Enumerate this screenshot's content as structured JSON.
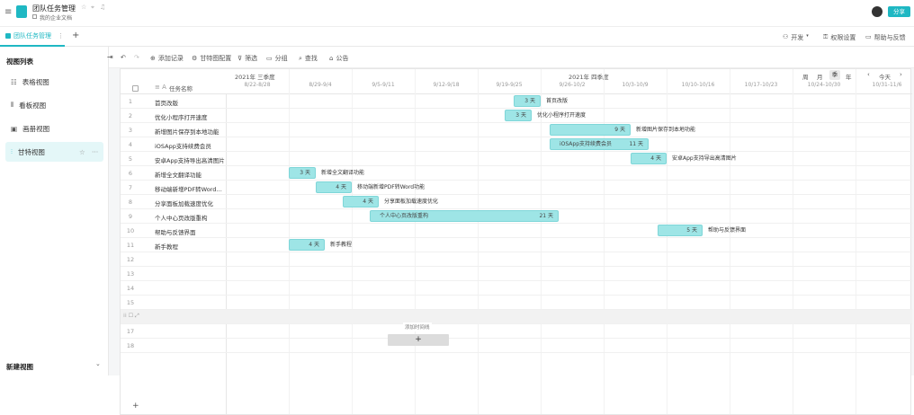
{
  "app": {
    "title": "团队任务管理",
    "workspace": "我的企业文档",
    "share_label": "分享",
    "brand_color": "#1fb8c3"
  },
  "tabs": {
    "active_label": "团队任务管理",
    "add_label": "+"
  },
  "topright": {
    "dev_label": "开发",
    "perm_label": "权限设置",
    "help_label": "帮助与反馈"
  },
  "sidebar": {
    "title": "视图列表",
    "items": [
      {
        "label": "表格视图",
        "icon": "table-icon"
      },
      {
        "label": "看板视图",
        "icon": "kanban-icon"
      },
      {
        "label": "画册视图",
        "icon": "gallery-icon"
      },
      {
        "label": "甘特视图",
        "icon": "gantt-icon"
      }
    ],
    "new_view_label": "新建视图"
  },
  "toolbar": {
    "add_record": "添加记录",
    "gantt_config": "甘特图配置",
    "filter": "筛选",
    "group": "分组",
    "find": "查找",
    "announce": "公告"
  },
  "gantt": {
    "header": {
      "check_label": "",
      "name_col": "任务名称",
      "q3_label": "2021年 三季度",
      "q4_label": "2021年 四季度",
      "scale_week": "周",
      "scale_month": "月",
      "scale_quarter": "季",
      "scale_year": "年",
      "today_label": "今天"
    },
    "weeks": [
      "8/22-8/28",
      "8/29-9/4",
      "9/5-9/11",
      "9/12-9/18",
      "9/19-9/25",
      "9/26-10/2",
      "10/3-10/9",
      "10/10-10/16",
      "10/17-10/23",
      "10/24-10/30",
      "10/31-11/6"
    ],
    "rows": [
      {
        "n": "1",
        "name": "首页改版"
      },
      {
        "n": "2",
        "name": "优化小程序打开速度"
      },
      {
        "n": "3",
        "name": "新增图片保存到本地功能"
      },
      {
        "n": "4",
        "name": "iOSApp支持续费会员"
      },
      {
        "n": "5",
        "name": "安卓App支持导出高清图片"
      },
      {
        "n": "6",
        "name": "新增全文翻译功能"
      },
      {
        "n": "7",
        "name": "移动端新增PDF转Word功能"
      },
      {
        "n": "8",
        "name": "分享面板加载速度优化"
      },
      {
        "n": "9",
        "name": "个人中心页改版重构"
      },
      {
        "n": "10",
        "name": "帮助与反馈界面"
      },
      {
        "n": "11",
        "name": "新手教程"
      },
      {
        "n": "12",
        "name": ""
      },
      {
        "n": "13",
        "name": ""
      },
      {
        "n": "14",
        "name": ""
      },
      {
        "n": "15",
        "name": ""
      },
      {
        "n": "16",
        "name": ""
      },
      {
        "n": "17",
        "name": ""
      },
      {
        "n": "18",
        "name": ""
      }
    ],
    "bars": [
      {
        "row": 0,
        "start": "2021-09-23",
        "days": 3,
        "dur": "3 天",
        "label": "首页改版",
        "inside": false
      },
      {
        "row": 1,
        "start": "2021-09-22",
        "days": 3,
        "dur": "3 天",
        "label": "优化小程序打开速度",
        "inside": false
      },
      {
        "row": 2,
        "start": "2021-09-27",
        "days": 9,
        "dur": "9 天",
        "label": "新增图片保存到本地功能",
        "inside": false
      },
      {
        "row": 3,
        "start": "2021-09-27",
        "days": 11,
        "dur": "11 天",
        "label": "iOSApp支持续费会员",
        "inside": true
      },
      {
        "row": 4,
        "start": "2021-10-06",
        "days": 4,
        "dur": "4 天",
        "label": "安卓App支持导出高清图片",
        "inside": false
      },
      {
        "row": 5,
        "start": "2021-08-29",
        "days": 3,
        "dur": "3 天",
        "label": "新增全文翻译功能",
        "inside": false
      },
      {
        "row": 6,
        "start": "2021-09-01",
        "days": 4,
        "dur": "4 天",
        "label": "移动端新增PDF转Word功能",
        "inside": false
      },
      {
        "row": 7,
        "start": "2021-09-04",
        "days": 4,
        "dur": "4 天",
        "label": "分享面板加载速度优化",
        "inside": false
      },
      {
        "row": 8,
        "start": "2021-09-07",
        "days": 21,
        "dur": "21 天",
        "label": "个人中心页改版重构",
        "inside": true
      },
      {
        "row": 9,
        "start": "2021-10-09",
        "days": 5,
        "dur": "5 天",
        "label": "帮助与反馈界面",
        "inside": false
      },
      {
        "row": 10,
        "start": "2021-08-29",
        "days": 4,
        "dur": "4 天",
        "label": "新手教程",
        "inside": false
      }
    ],
    "add_task_tip": "添加时间线",
    "add_row_label": "+"
  }
}
